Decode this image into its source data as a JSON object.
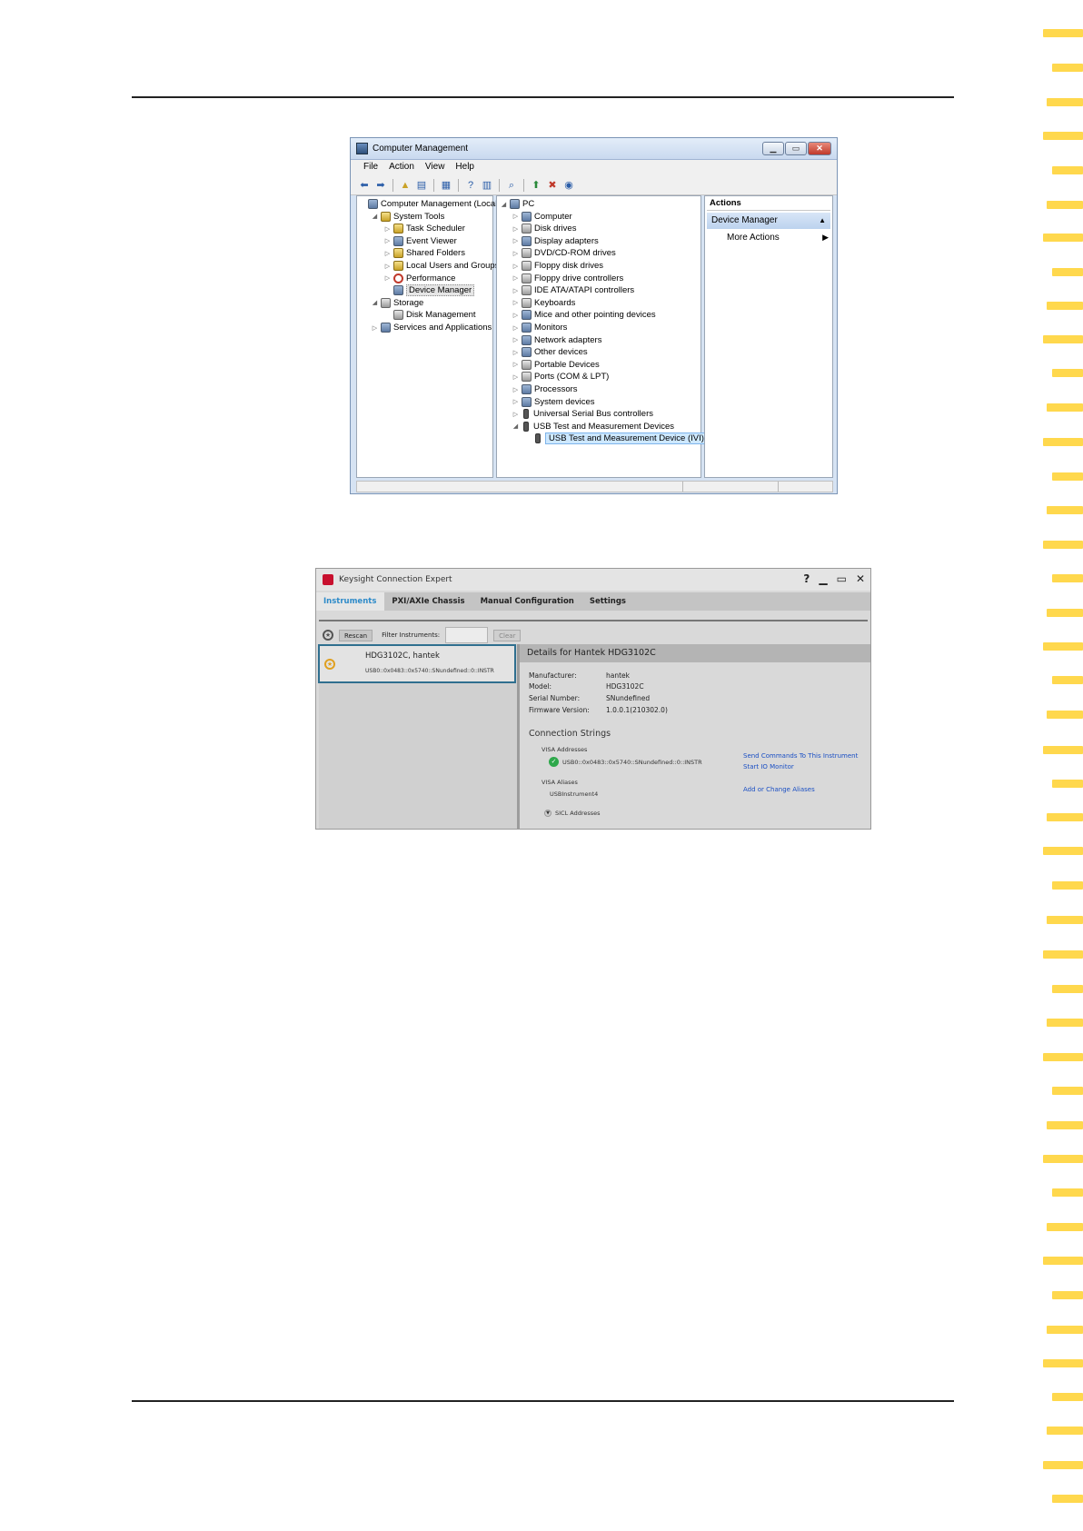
{
  "computer_management": {
    "title": "Computer Management",
    "menu": [
      "File",
      "Action",
      "View",
      "Help"
    ],
    "left_tree": [
      {
        "label": "Computer Management (Local)",
        "indent": 0,
        "arrow": "",
        "icon": "computer-management-icon"
      },
      {
        "label": "System Tools",
        "indent": 1,
        "arrow": "◢",
        "icon": "tools-icon"
      },
      {
        "label": "Task Scheduler",
        "indent": 2,
        "arrow": "▷",
        "icon": "clock-icon"
      },
      {
        "label": "Event Viewer",
        "indent": 2,
        "arrow": "▷",
        "icon": "event-viewer-icon"
      },
      {
        "label": "Shared Folders",
        "indent": 2,
        "arrow": "▷",
        "icon": "shared-folders-icon"
      },
      {
        "label": "Local Users and Groups",
        "indent": 2,
        "arrow": "▷",
        "icon": "users-icon"
      },
      {
        "label": "Performance",
        "indent": 2,
        "arrow": "▷",
        "icon": "performance-icon"
      },
      {
        "label": "Device Manager",
        "indent": 2,
        "arrow": "",
        "icon": "device-manager-icon",
        "selected": true
      },
      {
        "label": "Storage",
        "indent": 1,
        "arrow": "◢",
        "icon": "storage-icon"
      },
      {
        "label": "Disk Management",
        "indent": 2,
        "arrow": "",
        "icon": "disk-management-icon"
      },
      {
        "label": "Services and Applications",
        "indent": 1,
        "arrow": "▷",
        "icon": "services-icon"
      }
    ],
    "device_tree": [
      {
        "label": "PC",
        "indent": 0,
        "arrow": "◢",
        "icon": "pc-icon"
      },
      {
        "label": "Computer",
        "indent": 1,
        "arrow": "▷",
        "icon": "computer-icon"
      },
      {
        "label": "Disk drives",
        "indent": 1,
        "arrow": "▷",
        "icon": "disk-drive-icon"
      },
      {
        "label": "Display adapters",
        "indent": 1,
        "arrow": "▷",
        "icon": "display-adapter-icon"
      },
      {
        "label": "DVD/CD-ROM drives",
        "indent": 1,
        "arrow": "▷",
        "icon": "dvd-icon"
      },
      {
        "label": "Floppy disk drives",
        "indent": 1,
        "arrow": "▷",
        "icon": "floppy-icon"
      },
      {
        "label": "Floppy drive controllers",
        "indent": 1,
        "arrow": "▷",
        "icon": "floppy-controller-icon"
      },
      {
        "label": "IDE ATA/ATAPI controllers",
        "indent": 1,
        "arrow": "▷",
        "icon": "ide-icon"
      },
      {
        "label": "Keyboards",
        "indent": 1,
        "arrow": "▷",
        "icon": "keyboard-icon"
      },
      {
        "label": "Mice and other pointing devices",
        "indent": 1,
        "arrow": "▷",
        "icon": "mouse-icon"
      },
      {
        "label": "Monitors",
        "indent": 1,
        "arrow": "▷",
        "icon": "monitor-icon"
      },
      {
        "label": "Network adapters",
        "indent": 1,
        "arrow": "▷",
        "icon": "network-icon"
      },
      {
        "label": "Other devices",
        "indent": 1,
        "arrow": "▷",
        "icon": "other-devices-icon"
      },
      {
        "label": "Portable Devices",
        "indent": 1,
        "arrow": "▷",
        "icon": "portable-device-icon"
      },
      {
        "label": "Ports (COM & LPT)",
        "indent": 1,
        "arrow": "▷",
        "icon": "port-icon"
      },
      {
        "label": "Processors",
        "indent": 1,
        "arrow": "▷",
        "icon": "processor-icon"
      },
      {
        "label": "System devices",
        "indent": 1,
        "arrow": "▷",
        "icon": "system-device-icon"
      },
      {
        "label": "Universal Serial Bus controllers",
        "indent": 1,
        "arrow": "▷",
        "icon": "usb-icon"
      },
      {
        "label": "USB Test and Measurement Devices",
        "indent": 1,
        "arrow": "◢",
        "icon": "usb-icon"
      },
      {
        "label": "USB Test and Measurement Device (IVI)",
        "indent": 2,
        "arrow": "",
        "icon": "usb-icon",
        "selected": true
      }
    ],
    "actions": {
      "header": "Actions",
      "section": "Device Manager",
      "item": "More Actions"
    }
  },
  "connection_expert": {
    "title": "Keysight Connection Expert",
    "controls": [
      "?",
      "▁",
      "▭",
      "✕"
    ],
    "tabs": [
      {
        "label": "Instruments",
        "active": true
      },
      {
        "label": "PXI/AXIe Chassis",
        "active": false
      },
      {
        "label": "Manual Configuration",
        "active": false
      },
      {
        "label": "Settings",
        "active": false
      }
    ],
    "toolbar": {
      "rescan": "Rescan",
      "filter_label": "Filter Instruments:",
      "filter_value": "",
      "clear": "Clear"
    },
    "instrument_card": {
      "name": "HDG3102C,   hantek",
      "address": "USB0::0x0483::0x5740::SNundefined::0::INSTR"
    },
    "details": {
      "header": "Details for  Hantek  HDG3102C",
      "fields": [
        {
          "label": "Manufacturer:",
          "value": "hantek"
        },
        {
          "label": "Model:",
          "value": "HDG3102C"
        },
        {
          "label": "Serial Number:",
          "value": "SNundefined"
        },
        {
          "label": "Firmware Version:",
          "value": "1.0.0.1(210302.0)"
        }
      ],
      "connection_strings": "Connection Strings",
      "visa_addresses_label": "VISA Addresses",
      "visa_address": "USB0::0x0483::0x5740::SNundefined::0::INSTR",
      "visa_aliases_label": "VISA Aliases",
      "visa_alias": "USBInstrument4",
      "sicl_label": "SICL Addresses",
      "links": {
        "send_commands": "Send Commands To This Instrument",
        "io_monitor": "Start IO Monitor",
        "aliases": "Add or Change Aliases"
      }
    }
  },
  "colors": {
    "ruler_yellow": "#ffd84d",
    "active_tab": "#2e8bc9",
    "link_blue": "#1a4fc4",
    "ok_green": "#2ea84b"
  }
}
